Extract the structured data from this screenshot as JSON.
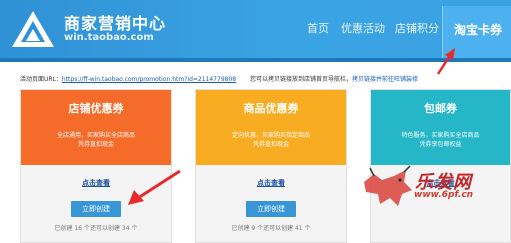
{
  "header": {
    "brand_title": "商家营销中心",
    "brand_sub": "win.taobao.com",
    "nav": [
      {
        "label": "首页"
      },
      {
        "label": "优惠活动"
      },
      {
        "label": "店铺积分"
      },
      {
        "label": "淘宝卡券"
      }
    ]
  },
  "url_bar": {
    "prefix": "活动页面URL：",
    "url": "https://ff-win.taobao.com/promotion.htm?id=2114779808",
    "hint": "您可以拷贝链接放到店铺首页导航栏，",
    "hint_link": "拷贝链接并前往旺铺装修"
  },
  "cards": [
    {
      "title": "店铺优惠券",
      "desc_line1": "全店通用，买家购买全店商品",
      "desc_line2": "凭券直扣现金",
      "view": "点击查看",
      "button": "立即创建",
      "stats": "已创建 16 个还可以创建 34 个",
      "color": "#f46b2a"
    },
    {
      "title": "商品优惠券",
      "desc_line1": "定向优惠，买家购买指定商品",
      "desc_line2": "凭券直扣现金",
      "view": "点击查看",
      "button": "立即创建",
      "stats": "已创建 9 个还可以创建 41 个",
      "color": "#f8ac22"
    },
    {
      "title": "包邮券",
      "desc_line1": "特色服务，买家购买全店商品",
      "desc_line2": "凭券享包邮权益",
      "view": "点击查看",
      "button": "立即创建",
      "stats": "已创建 0 个还可以创建 50 个",
      "color": "#25b7c8"
    }
  ],
  "watermark": {
    "cn": "乐发网",
    "site": "www.6pf.cn"
  }
}
